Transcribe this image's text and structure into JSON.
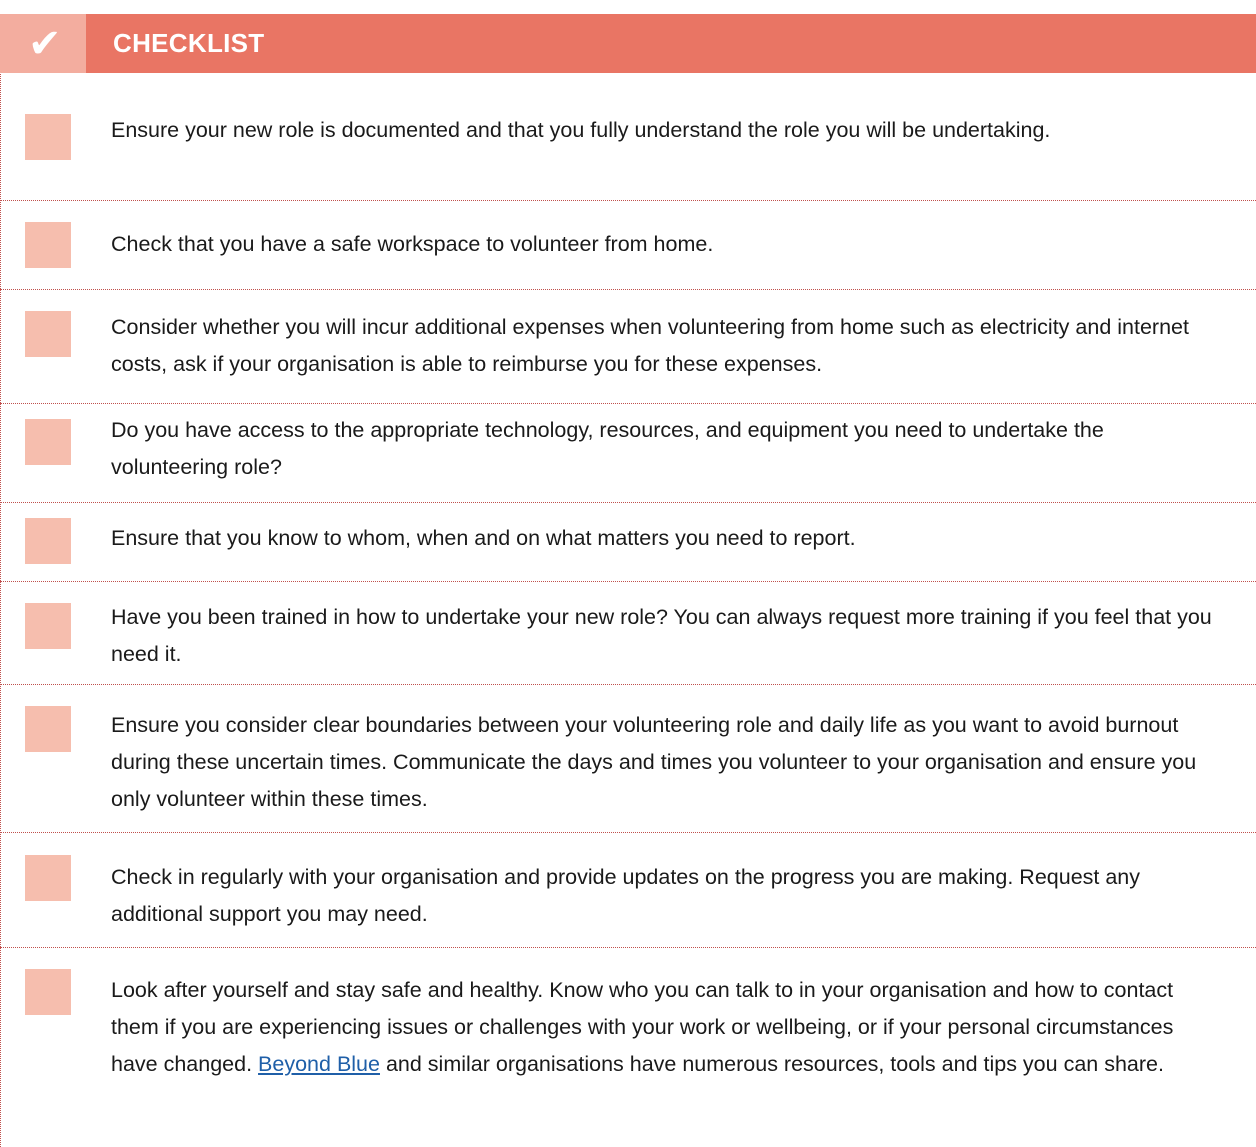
{
  "header": {
    "tick_icon": "✔",
    "title": "CHECKLIST"
  },
  "items": [
    {
      "text": "Ensure your new role is documented and that you fully understand the role you will be undertaking."
    },
    {
      "text": "Check that you have a safe workspace to volunteer from home."
    },
    {
      "text": "Consider whether you will incur additional expenses when volunteering from home such as electricity and internet costs, ask if your organisation is able to reimburse you for these expenses."
    },
    {
      "text": "Do you have access to the appropriate technology, resources, and equipment you need to undertake the volunteering role?"
    },
    {
      "text": "Ensure that you know to whom, when and on what matters you need to report."
    },
    {
      "text": "Have you been trained in how to undertake your new role? You can always request more training if you feel that you need it."
    },
    {
      "text": "Ensure you consider clear boundaries between your volunteering role and daily life as you want to avoid burnout during these uncertain times. Communicate the days and times you volunteer to your organisation and ensure you only volunteer within these times."
    },
    {
      "text": "Check in regularly with your organisation and provide updates on the progress you are making. Request any additional support you may need."
    },
    {
      "text_before": "Look after yourself and stay safe and healthy. Know who you can talk to in your organisation and how to contact them if you are experiencing issues or challenges with your work or wellbeing, or if your personal circumstances have changed. ",
      "link_text": "Beyond Blue",
      "text_after": " and similar organisations have numerous resources, tools and tips you can share."
    }
  ],
  "colors": {
    "header_bg": "#e97564",
    "tick_cell_bg": "#f3ad9f",
    "checkbox_bg": "#f6beae",
    "divider": "#c0504d",
    "link": "#1f5fa8"
  }
}
